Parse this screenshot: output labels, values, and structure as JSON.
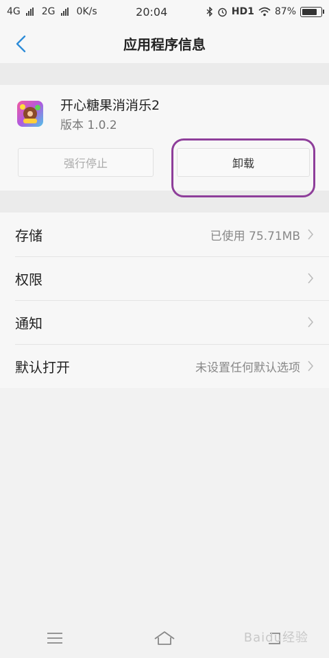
{
  "status_bar": {
    "network1": "4G",
    "network2": "2G",
    "speed": "0K/s",
    "time": "20:04",
    "hd": "HD1",
    "battery_text": "87%",
    "battery_level": 0.87
  },
  "header": {
    "title": "应用程序信息"
  },
  "app": {
    "name": "开心糖果消消乐2",
    "version": "版本 1.0.2",
    "icon_name": "candy-game-icon"
  },
  "buttons": {
    "force_stop": "强行停止",
    "uninstall": "卸载"
  },
  "settings": [
    {
      "label": "存储",
      "value": "已使用 75.71MB"
    },
    {
      "label": "权限",
      "value": ""
    },
    {
      "label": "通知",
      "value": ""
    },
    {
      "label": "默认打开",
      "value": "未设置任何默认选项"
    }
  ],
  "watermark": "Baidu经验",
  "colors": {
    "accent": "#2d8cd8",
    "highlight": "#8e3e9a"
  }
}
